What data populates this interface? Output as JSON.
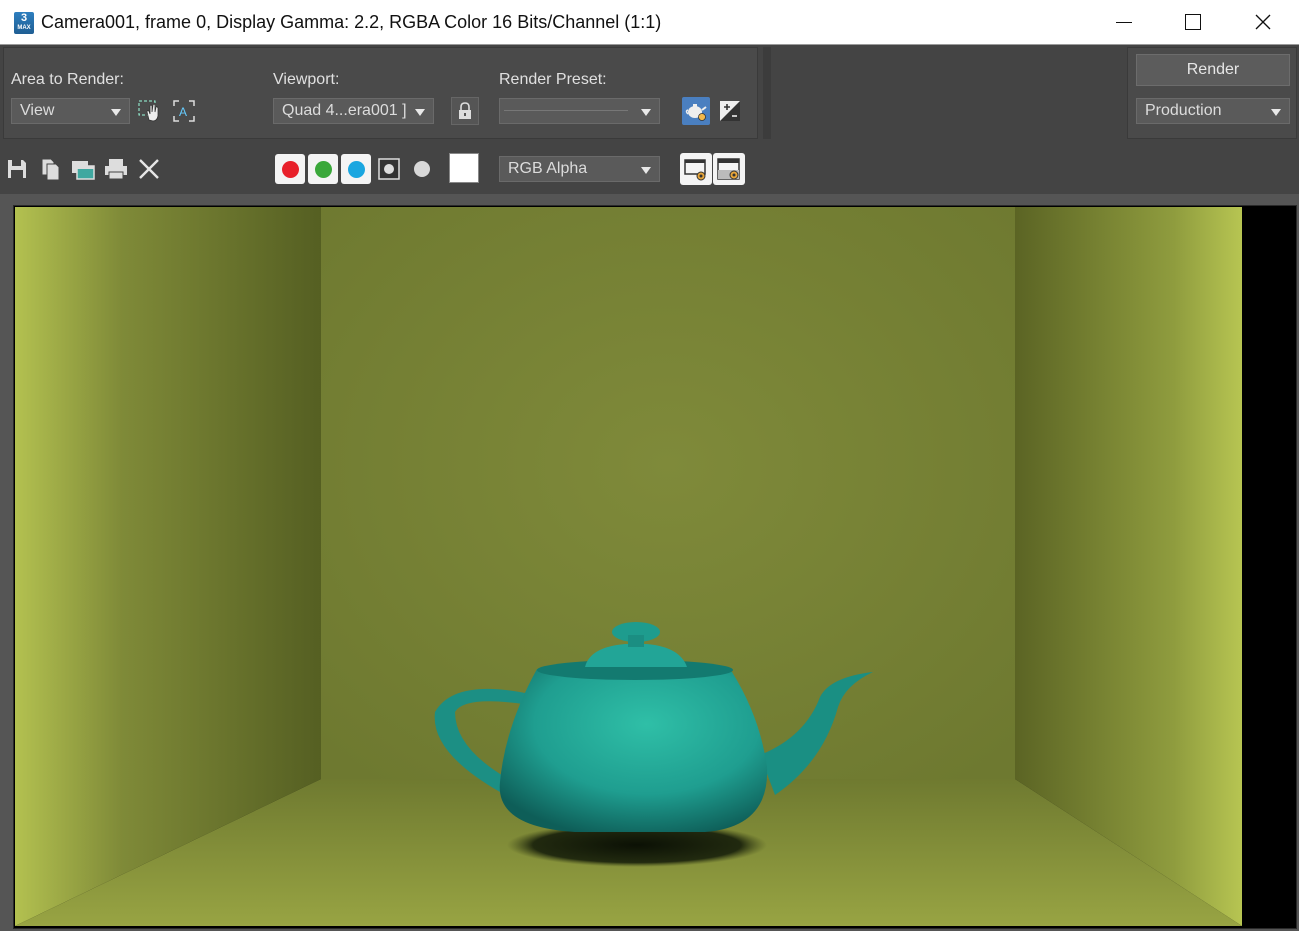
{
  "window": {
    "app_icon_label": "3",
    "app_icon_sublabel": "MAX",
    "title": "Camera001, frame 0, Display Gamma: 2.2, RGBA Color 16 Bits/Channel (1:1)"
  },
  "controls": {
    "area_to_render_label": "Area to Render:",
    "area_to_render_value": "View",
    "viewport_label": "Viewport:",
    "viewport_value": "Quad 4...era001 ]",
    "render_preset_label": "Render Preset:",
    "render_preset_value": "",
    "render_button_label": "Render",
    "render_mode_value": "Production"
  },
  "toolbar": {
    "channel_display_value": "RGB Alpha",
    "icons": [
      "save-icon",
      "copy-icon",
      "clone-window-icon",
      "print-icon",
      "clear-icon"
    ],
    "channels": [
      {
        "name": "red",
        "color": "#e8202a",
        "active": true
      },
      {
        "name": "green",
        "color": "#3aa83a",
        "active": true
      },
      {
        "name": "blue",
        "color": "#1aa6e0",
        "active": true
      },
      {
        "name": "alpha",
        "active": false
      },
      {
        "name": "monochrome",
        "active": false
      }
    ],
    "swatch_color": "#ffffff"
  },
  "colors": {
    "ui_background": "#444444",
    "accent_blue": "#4a7fc0",
    "wall_color": "#7e8a3a",
    "teapot_color": "#22a89a"
  }
}
